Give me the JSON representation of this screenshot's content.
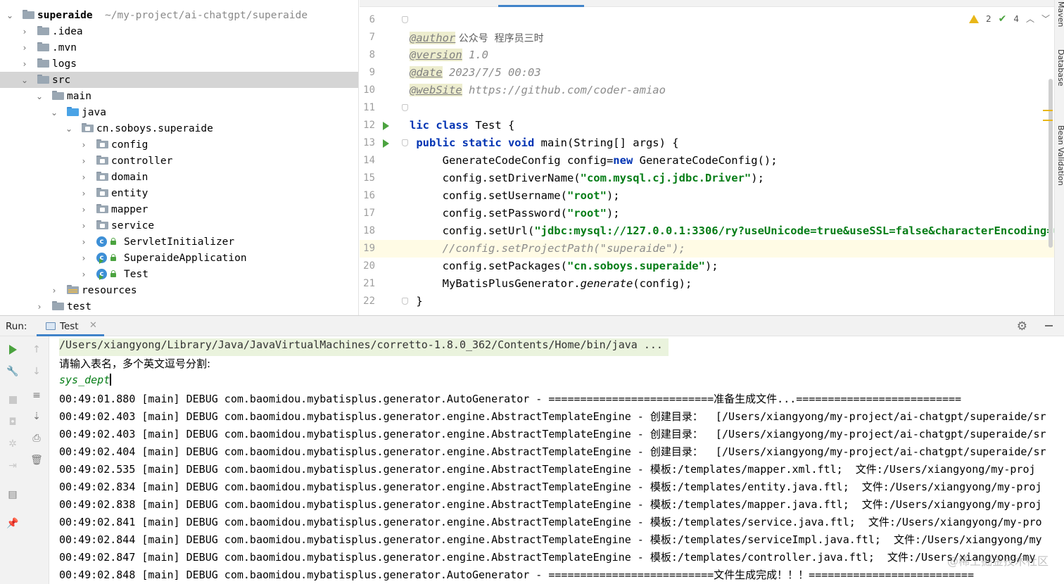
{
  "project": {
    "root_name": "superaide",
    "root_path": "~/my-project/ai-chatgpt/superaide",
    "items": [
      {
        "label": "superaide",
        "kind": "root"
      },
      {
        "label": ".idea",
        "kind": "folder"
      },
      {
        "label": ".mvn",
        "kind": "folder"
      },
      {
        "label": "logs",
        "kind": "folder"
      },
      {
        "label": "src",
        "kind": "folder",
        "selected": true
      },
      {
        "label": "main",
        "kind": "folder"
      },
      {
        "label": "java",
        "kind": "source-folder"
      },
      {
        "label": "cn.soboys.superaide",
        "kind": "package"
      },
      {
        "label": "config",
        "kind": "package"
      },
      {
        "label": "controller",
        "kind": "package"
      },
      {
        "label": "domain",
        "kind": "package"
      },
      {
        "label": "entity",
        "kind": "package"
      },
      {
        "label": "mapper",
        "kind": "package"
      },
      {
        "label": "service",
        "kind": "package"
      },
      {
        "label": "ServletInitializer",
        "kind": "class"
      },
      {
        "label": "SuperaideApplication",
        "kind": "class"
      },
      {
        "label": "Test",
        "kind": "class"
      },
      {
        "label": "resources",
        "kind": "resources"
      },
      {
        "label": "test",
        "kind": "folder"
      }
    ]
  },
  "editor": {
    "inspections": {
      "warnings": "2",
      "ok": "4"
    },
    "current_line": "19",
    "lines": [
      {
        "n": "6"
      },
      {
        "n": "7",
        "tag": "@author",
        "text": " 公众号  程序员三时"
      },
      {
        "n": "8",
        "tag": "@version",
        "text": " 1.0"
      },
      {
        "n": "9",
        "tag": "@date",
        "text": " 2023/7/5 00:03"
      },
      {
        "n": "10",
        "tag": "@webSite",
        "text": " https://github.com/coder-amiao"
      },
      {
        "n": "11"
      },
      {
        "n": "12",
        "kw": "lic class",
        "text": " Test {"
      },
      {
        "n": "13",
        "kw": " public static void",
        "text": " main(String[] args) {"
      },
      {
        "n": "14",
        "pre": "     GenerateCodeConfig config=",
        "kw": "new",
        "text": " GenerateCodeConfig();"
      },
      {
        "n": "15",
        "pre": "     config.setDriverName(",
        "str": "\"com.mysql.cj.jdbc.Driver\"",
        "text": ");"
      },
      {
        "n": "16",
        "pre": "     config.setUsername(",
        "str": "\"root\"",
        "text": ");"
      },
      {
        "n": "17",
        "pre": "     config.setPassword(",
        "str": "\"root\"",
        "text": ");"
      },
      {
        "n": "18",
        "pre": "     config.setUrl(",
        "str": "\"jdbc:mysql://127.0.0.1:3306/ry?useUnicode=true&useSSL=false&characterEncoding=ut",
        "text": ""
      },
      {
        "n": "19",
        "comment": "     //config.setProjectPath(\"superaide\");"
      },
      {
        "n": "20",
        "pre": "     config.setPackages(",
        "str": "\"cn.soboys.superaide\"",
        "text": ");"
      },
      {
        "n": "21",
        "pre": "     MyBatisPlusGenerator.",
        "italic": "generate",
        "text": "(config);"
      },
      {
        "n": "22",
        "pre": " }"
      }
    ]
  },
  "right_strip": {
    "maven": "Maven",
    "database": "Database",
    "bean": "Bean Validation"
  },
  "run_panel": {
    "label": "Run:",
    "tab": "Test",
    "console": [
      "/Users/xiangyong/Library/Java/JavaVirtualMachines/corretto-1.8.0_362/Contents/Home/bin/java ...",
      "请输入表名，多个英文逗号分割:",
      "sys_dept",
      "00:49:01.880 [main] DEBUG com.baomidou.mybatisplus.generator.AutoGenerator - ==========================准备生成文件...==========================",
      "00:49:02.403 [main] DEBUG com.baomidou.mybatisplus.generator.engine.AbstractTemplateEngine - 创建目录：  [/Users/xiangyong/my-project/ai-chatgpt/superaide/sr",
      "00:49:02.403 [main] DEBUG com.baomidou.mybatisplus.generator.engine.AbstractTemplateEngine - 创建目录：  [/Users/xiangyong/my-project/ai-chatgpt/superaide/sr",
      "00:49:02.404 [main] DEBUG com.baomidou.mybatisplus.generator.engine.AbstractTemplateEngine - 创建目录：  [/Users/xiangyong/my-project/ai-chatgpt/superaide/sr",
      "00:49:02.535 [main] DEBUG com.baomidou.mybatisplus.generator.engine.AbstractTemplateEngine - 模板:/templates/mapper.xml.ftl;  文件:/Users/xiangyong/my-proj",
      "00:49:02.834 [main] DEBUG com.baomidou.mybatisplus.generator.engine.AbstractTemplateEngine - 模板:/templates/entity.java.ftl;  文件:/Users/xiangyong/my-proj",
      "00:49:02.838 [main] DEBUG com.baomidou.mybatisplus.generator.engine.AbstractTemplateEngine - 模板:/templates/mapper.java.ftl;  文件:/Users/xiangyong/my-proj",
      "00:49:02.841 [main] DEBUG com.baomidou.mybatisplus.generator.engine.AbstractTemplateEngine - 模板:/templates/service.java.ftl;  文件:/Users/xiangyong/my-pro",
      "00:49:02.844 [main] DEBUG com.baomidou.mybatisplus.generator.engine.AbstractTemplateEngine - 模板:/templates/serviceImpl.java.ftl;  文件:/Users/xiangyong/my",
      "00:49:02.847 [main] DEBUG com.baomidou.mybatisplus.generator.engine.AbstractTemplateEngine - 模板:/templates/controller.java.ftl;  文件:/Users/xiangyong/my",
      "00:49:02.848 [main] DEBUG com.baomidou.mybatisplus.generator.AutoGenerator - ==========================文件生成完成！！！=========================="
    ]
  },
  "watermark": "@稀土掘金技术社区",
  "colors": {
    "accent": "#4083c9",
    "run_green": "#4ba33f",
    "string_green": "#067d17",
    "keyword_blue": "#0033b3",
    "warning_yellow": "#e8b618"
  }
}
